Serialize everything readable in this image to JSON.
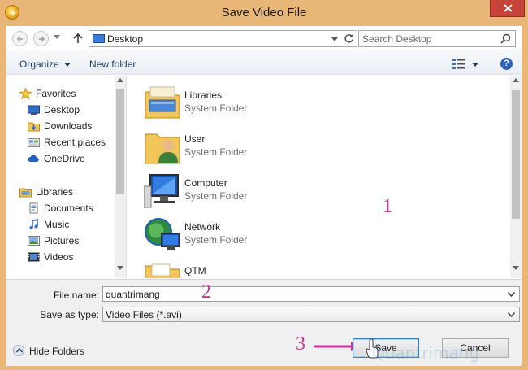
{
  "window": {
    "title": "Save Video File"
  },
  "navbar": {
    "address": "Desktop",
    "search_placeholder": "Search Desktop"
  },
  "toolbar": {
    "organize_label": "Organize",
    "new_folder_label": "New folder",
    "help_label": "?"
  },
  "nav_pane": {
    "groups": [
      {
        "label": "Favorites",
        "icon": "star-icon",
        "items": [
          {
            "label": "Desktop",
            "icon": "desktop-icon"
          },
          {
            "label": "Downloads",
            "icon": "downloads-icon"
          },
          {
            "label": "Recent places",
            "icon": "recent-places-icon"
          },
          {
            "label": "OneDrive",
            "icon": "onedrive-icon"
          }
        ]
      },
      {
        "label": "Libraries",
        "icon": "libraries-icon",
        "items": [
          {
            "label": "Documents",
            "icon": "documents-icon"
          },
          {
            "label": "Music",
            "icon": "music-icon"
          },
          {
            "label": "Pictures",
            "icon": "pictures-icon"
          },
          {
            "label": "Videos",
            "icon": "videos-icon"
          }
        ]
      }
    ]
  },
  "files": [
    {
      "name": "Libraries",
      "type": "System Folder",
      "icon": "libraries-folder-icon"
    },
    {
      "name": "User",
      "type": "System Folder",
      "icon": "user-folder-icon"
    },
    {
      "name": "Computer",
      "type": "System Folder",
      "icon": "computer-icon"
    },
    {
      "name": "Network",
      "type": "System Folder",
      "icon": "network-icon"
    },
    {
      "name": "QTM",
      "type": "",
      "icon": "folder-icon"
    }
  ],
  "form": {
    "file_name_label": "File name:",
    "file_name_value": "quantrimang",
    "save_type_label": "Save as type:",
    "save_type_value": "Video Files (*.avi)"
  },
  "footer": {
    "hide_folders_label": "Hide Folders",
    "save_label": "Save",
    "cancel_label": "Cancel"
  },
  "annotations": {
    "marker_1": "1",
    "marker_2": "2",
    "marker_3": "3",
    "watermark": "Quantrimang"
  },
  "colors": {
    "title_bar": "#e8b676",
    "close_button": "#c7443a",
    "annotation": "#c0399a"
  }
}
